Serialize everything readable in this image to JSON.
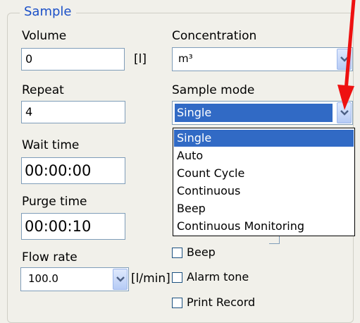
{
  "group": {
    "title": "Sample"
  },
  "volume": {
    "label": "Volume",
    "value": "0",
    "unit": "[l]"
  },
  "concentration": {
    "label": "Concentration",
    "value": "m³"
  },
  "repeat": {
    "label": "Repeat",
    "value": "4"
  },
  "sample_mode": {
    "label": "Sample mode",
    "value": "Single",
    "options": [
      "Single",
      "Auto",
      "Count Cycle",
      "Continuous",
      "Beep",
      "Continuous Monitoring"
    ],
    "highlighted_option": "Single"
  },
  "wait_time": {
    "label": "Wait time",
    "value": "00:00:00"
  },
  "purge_time": {
    "label": "Purge time",
    "value": "00:00:10"
  },
  "flow_rate": {
    "label": "Flow rate",
    "value": "100.0",
    "unit": "[l/min]"
  },
  "checkboxes": [
    {
      "label": "Beep",
      "checked": false
    },
    {
      "label": "Alarm tone",
      "checked": false
    },
    {
      "label": "Print Record",
      "checked": false
    }
  ],
  "icons": {
    "dropdown": "chevron-down-icon",
    "annotation": "red-arrow-icon"
  },
  "colors": {
    "accent": "#1b50c8",
    "selection": "#316ac5",
    "annotation_arrow": "#ee1111"
  }
}
